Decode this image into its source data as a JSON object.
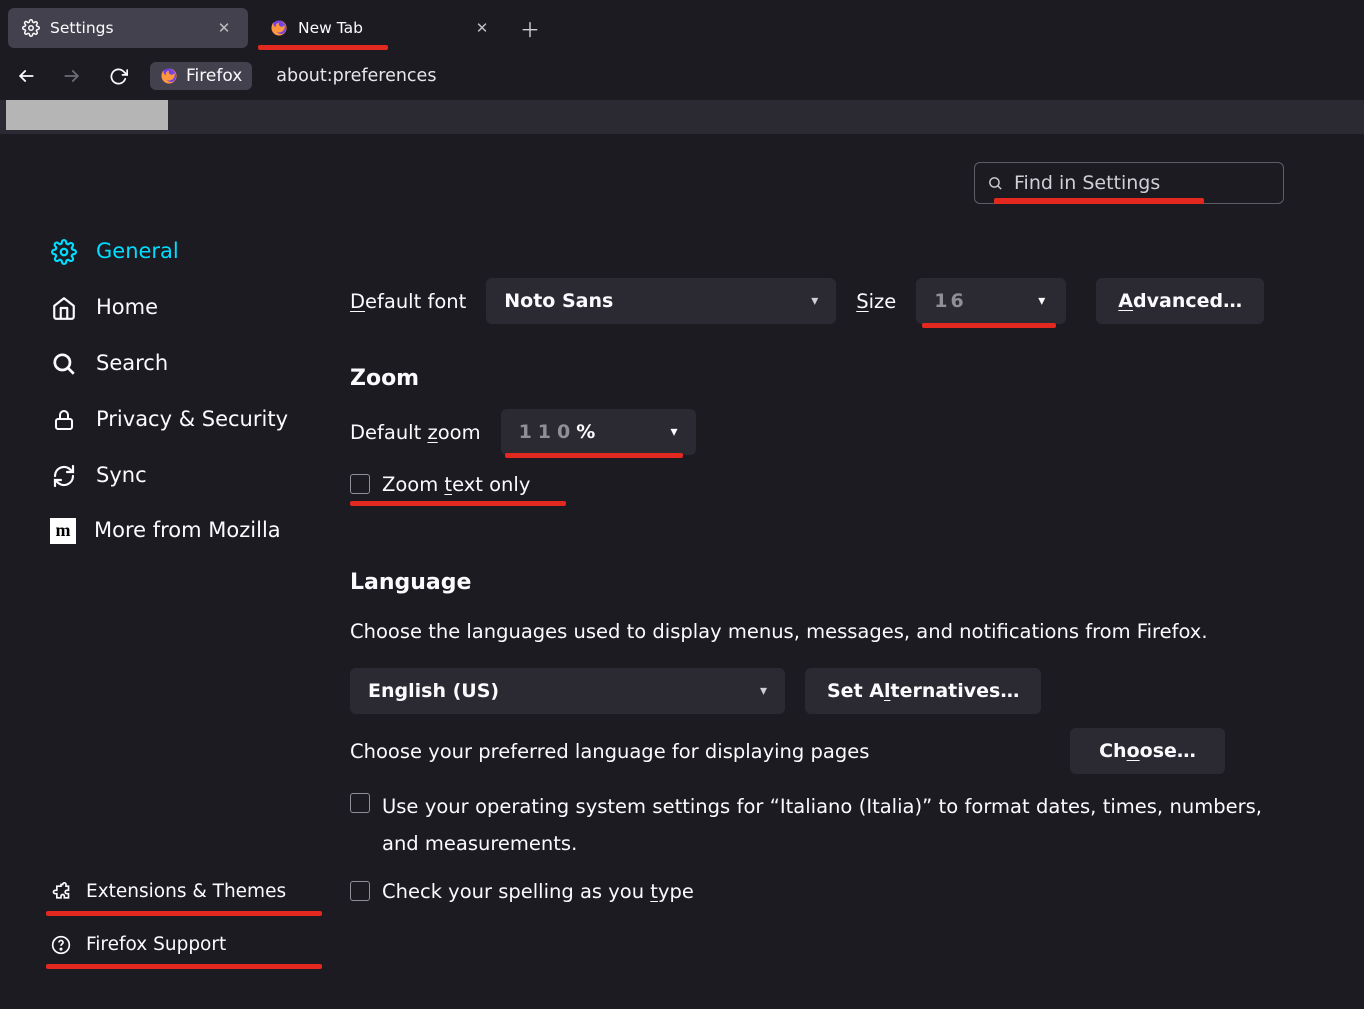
{
  "tabs": [
    {
      "label": "Settings",
      "active": true
    },
    {
      "label": "New Tab",
      "active": false
    }
  ],
  "url": {
    "identity": "Firefox",
    "address": "about:preferences"
  },
  "search": {
    "placeholder": "Find in Settings"
  },
  "sidebar": {
    "items": [
      {
        "label": "General"
      },
      {
        "label": "Home"
      },
      {
        "label": "Search"
      },
      {
        "label": "Privacy & Security"
      },
      {
        "label": "Sync"
      },
      {
        "label": "More from Mozilla"
      }
    ],
    "footer": [
      {
        "label": "Extensions & Themes"
      },
      {
        "label": "Firefox Support"
      }
    ]
  },
  "fonts": {
    "default_label_pre": "D",
    "default_label_post": "efault font",
    "default_value": "Noto Sans",
    "size_label_pre": "S",
    "size_label_post": "ize",
    "size_value": "16",
    "advanced_pre": "A",
    "advanced_post": "dvanced…"
  },
  "zoom": {
    "heading": "Zoom",
    "default_pre": "Default ",
    "default_ul": "z",
    "default_post": "oom",
    "value_num": "110",
    "value_pct": "%",
    "text_only_pre": "Zoom ",
    "text_only_ul": "t",
    "text_only_post": "ext only"
  },
  "language": {
    "heading": "Language",
    "desc": "Choose the languages used to display menus, messages, and notifications from Firefox.",
    "selected": "English (US)",
    "set_alt_pre": "Set A",
    "set_alt_ul": "l",
    "set_alt_post": "ternatives…",
    "pref_text": "Choose your preferred language for displaying pages",
    "choose_pre": "Ch",
    "choose_ul": "o",
    "choose_post": "ose…",
    "os_text": "Use your operating system settings for “Italiano (Italia)” to format dates, times, numbers, and measurements.",
    "spell_pre": "Check your spelling as you ",
    "spell_ul": "t",
    "spell_post": "ype"
  }
}
